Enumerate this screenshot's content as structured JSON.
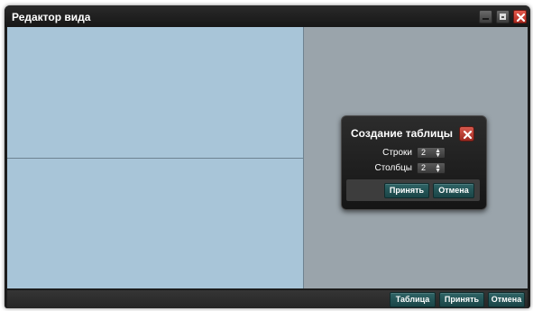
{
  "window": {
    "title": "Редактор вида"
  },
  "dialog": {
    "title": "Создание таблицы",
    "rows_label": "Строки",
    "rows_value": "2",
    "cols_label": "Столбцы",
    "cols_value": "2",
    "accept_label": "Принять",
    "cancel_label": "Отмена"
  },
  "toolbar": {
    "table_label": "Таблица",
    "accept_label": "Принять",
    "cancel_label": "Отмена"
  },
  "colors": {
    "preview_bg": "#a8c5d8",
    "workspace_bg": "#9aa4ab",
    "button_accent": "#2f6466",
    "close_red": "#c8372c"
  },
  "icons": {
    "minimize": "minimize-icon",
    "maximize": "maximize-icon",
    "close": "close-icon",
    "spinner": "up-down-arrows-icon"
  }
}
